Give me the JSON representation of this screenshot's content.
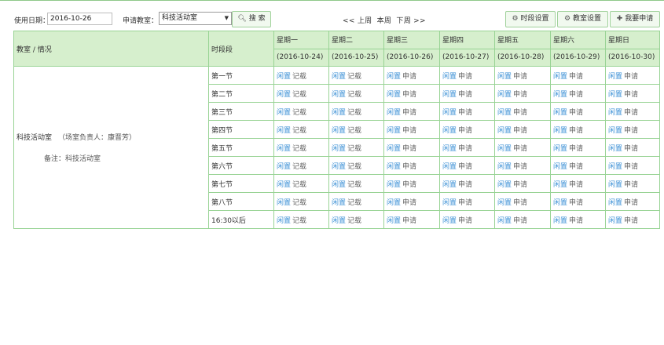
{
  "filters": {
    "date_label": "使用日期：",
    "date_value": "2016-10-26",
    "room_label": "申请教室：",
    "room_value": "科技活动室",
    "search_label": "搜 索"
  },
  "week_nav": {
    "prev": "<< 上周",
    "current": "本周",
    "next": "下周 >>"
  },
  "buttons": {
    "time_settings": "时段设置",
    "room_settings": "教室设置",
    "apply": "我要申请"
  },
  "table": {
    "room_header": "教室 / 情况",
    "time_header": "时段段",
    "days": [
      {
        "name": "星期一",
        "date": "(2016-10-24)",
        "today": false
      },
      {
        "name": "星期二",
        "date": "(2016-10-25)",
        "today": false
      },
      {
        "name": "星期三",
        "date": "(2016-10-26)",
        "today": true
      },
      {
        "name": "星期四",
        "date": "(2016-10-27)",
        "today": false
      },
      {
        "name": "星期五",
        "date": "(2016-10-28)",
        "today": false
      },
      {
        "name": "星期六",
        "date": "(2016-10-29)",
        "today": false
      },
      {
        "name": "星期日",
        "date": "(2016-10-30)",
        "today": false
      }
    ],
    "room": {
      "name": "科技活动室",
      "manager": "（场室负责人：康晋芳）",
      "note": "备注：科技活动室"
    },
    "periods": [
      "第一节",
      "第二节",
      "第三节",
      "第四节",
      "第五节",
      "第六节",
      "第七节",
      "第八节",
      "16:30以后"
    ],
    "status_free": "闲置",
    "action_past": "记载",
    "action_future": "申请"
  },
  "colors": {
    "accent_border": "#98d394",
    "header_bg": "#d6efcd",
    "today_text": "#e02020",
    "link": "#3a8fd6"
  }
}
